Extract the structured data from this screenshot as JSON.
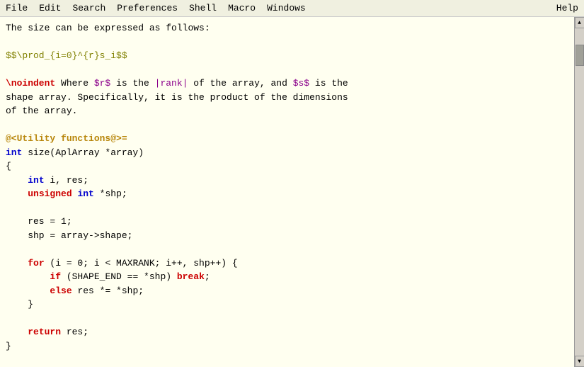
{
  "menubar": {
    "items": [
      "File",
      "Edit",
      "Search",
      "Preferences",
      "Shell",
      "Macro",
      "Windows"
    ],
    "help": "Help"
  },
  "editor": {
    "lines": []
  }
}
